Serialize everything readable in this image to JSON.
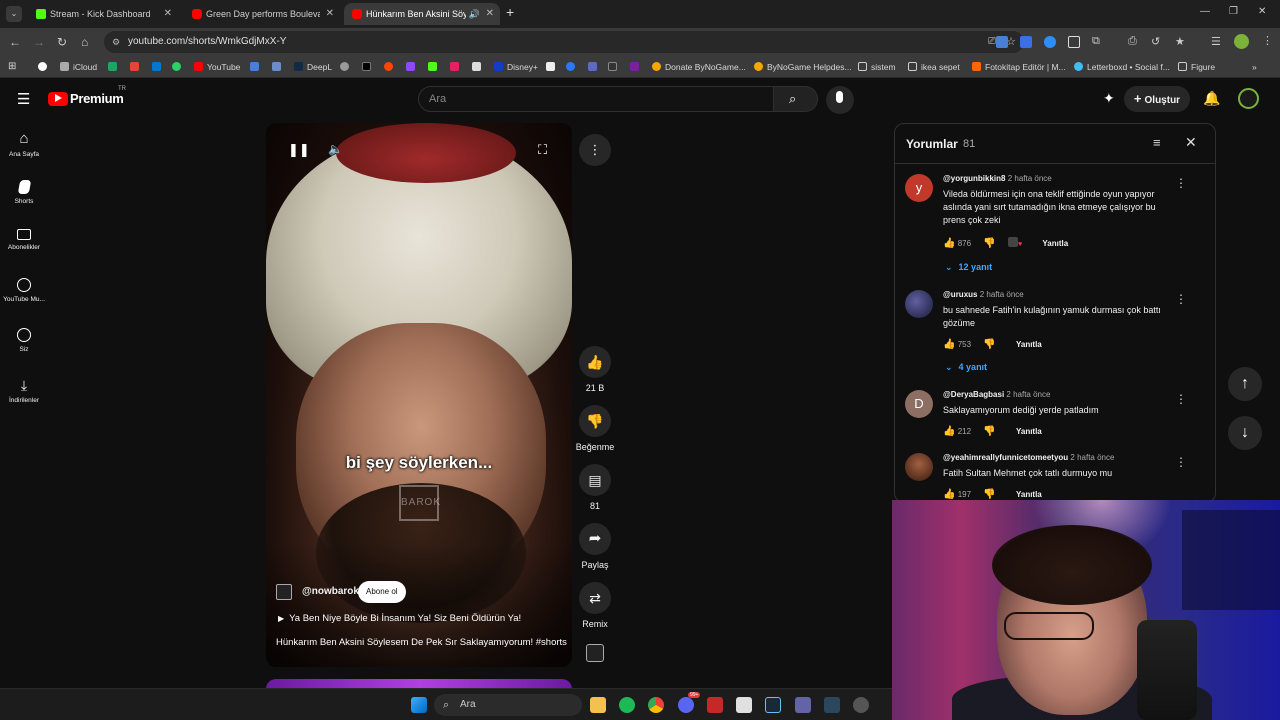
{
  "browser": {
    "tabs": [
      {
        "title": "Stream - Kick Dashboard",
        "color": "#53fc18"
      },
      {
        "title": "Green Day performs Boulevard",
        "color": "#ff0000"
      },
      {
        "title": "Hünkarım Ben Aksini Söyles",
        "color": "#ff0000"
      }
    ],
    "new_tab_label": "+",
    "url": "youtube.com/shorts/WmkGdjMxX-Y",
    "bookmarks": [
      {
        "label": "iCloud",
        "color": "#aaaaaa"
      },
      {
        "label": "YouTube",
        "color": "#ff0000"
      },
      {
        "label": "DeepL",
        "color": "#0f2b46"
      },
      {
        "label": "Disney+",
        "color": "#113ccf"
      },
      {
        "label": "Donate ByNoGame...",
        "color": "#f6a700"
      },
      {
        "label": "ByNoGame Helpdes...",
        "color": "#f6a700"
      },
      {
        "label": "sistem",
        "color": "#cccccc"
      },
      {
        "label": "ikea sepet",
        "color": "#cccccc"
      },
      {
        "label": "Fotokitap Editör | M...",
        "color": "#ff6600"
      },
      {
        "label": "Letterboxd • Social f...",
        "color": "#40bcf4"
      },
      {
        "label": "Figure",
        "color": "#cccccc"
      }
    ]
  },
  "youtube": {
    "logo_text": "Premium",
    "logo_region": "TR",
    "search_placeholder": "Ara",
    "create_label": "Oluştur",
    "sidebar": [
      {
        "label": "Ana Sayfa"
      },
      {
        "label": "Shorts"
      },
      {
        "label": "Abonelikler"
      },
      {
        "label": "YouTube Mu..."
      },
      {
        "label": "Siz"
      },
      {
        "label": "İndirilenler"
      }
    ]
  },
  "video": {
    "subtitle": "bi şey söylerken...",
    "watermark": "BAROK",
    "channel": "@nowbarok",
    "subscribe_label": "Abone ol",
    "music": "Ya Ben Niye Böyle Bi İnsanım Ya! Siz Beni Öldürün Ya!",
    "title": "Hünkarım Ben Aksini Söylesem De Pek Sır Saklayamıyorum! #shorts",
    "actions": {
      "likes": "21 B",
      "dislike_label": "Beğenme",
      "comments": "81",
      "share_label": "Paylaş",
      "remix_label": "Remix"
    }
  },
  "comments": {
    "header": "Yorumlar",
    "count": "81",
    "items": [
      {
        "avatar_letter": "y",
        "avatar_color": "#c0392b",
        "user": "@yorgunbikkin8",
        "time": "2 hafta önce",
        "text": "Vileda öldürmesi için ona teklif ettiğinde oyun yapıyor aslında yani sırt tutamadığın ikna etmeye çalışıyor bu prens çok zeki",
        "likes": "876",
        "reply_label": "Yanıtla",
        "replies": "12 yanıt"
      },
      {
        "avatar_letter": "",
        "avatar_color": "#2a2a4a",
        "user": "@uruxus",
        "time": "2 hafta önce",
        "text": "bu sahnede Fatih'in kulağının yamuk durması çok battı gözüme",
        "likes": "753",
        "reply_label": "Yanıtla",
        "replies": "4 yanıt"
      },
      {
        "avatar_letter": "D",
        "avatar_color": "#8d6e63",
        "user": "@DeryaBagbasi",
        "time": "2 hafta önce",
        "text": "Saklayamıyorum dediği yerde patladım",
        "likes": "212",
        "reply_label": "Yanıtla",
        "replies": ""
      },
      {
        "avatar_letter": "",
        "avatar_color": "#5a3a2a",
        "user": "@yeahimreallyfunnicetomeetyou",
        "time": "2 hafta önce",
        "text": "Fatih Sultan Mehmet çok tatlı durmuyo mu",
        "likes": "197",
        "reply_label": "Yanıtla",
        "replies": ""
      }
    ]
  },
  "taskbar": {
    "search_placeholder": "Ara",
    "discord_badge": "99+"
  }
}
